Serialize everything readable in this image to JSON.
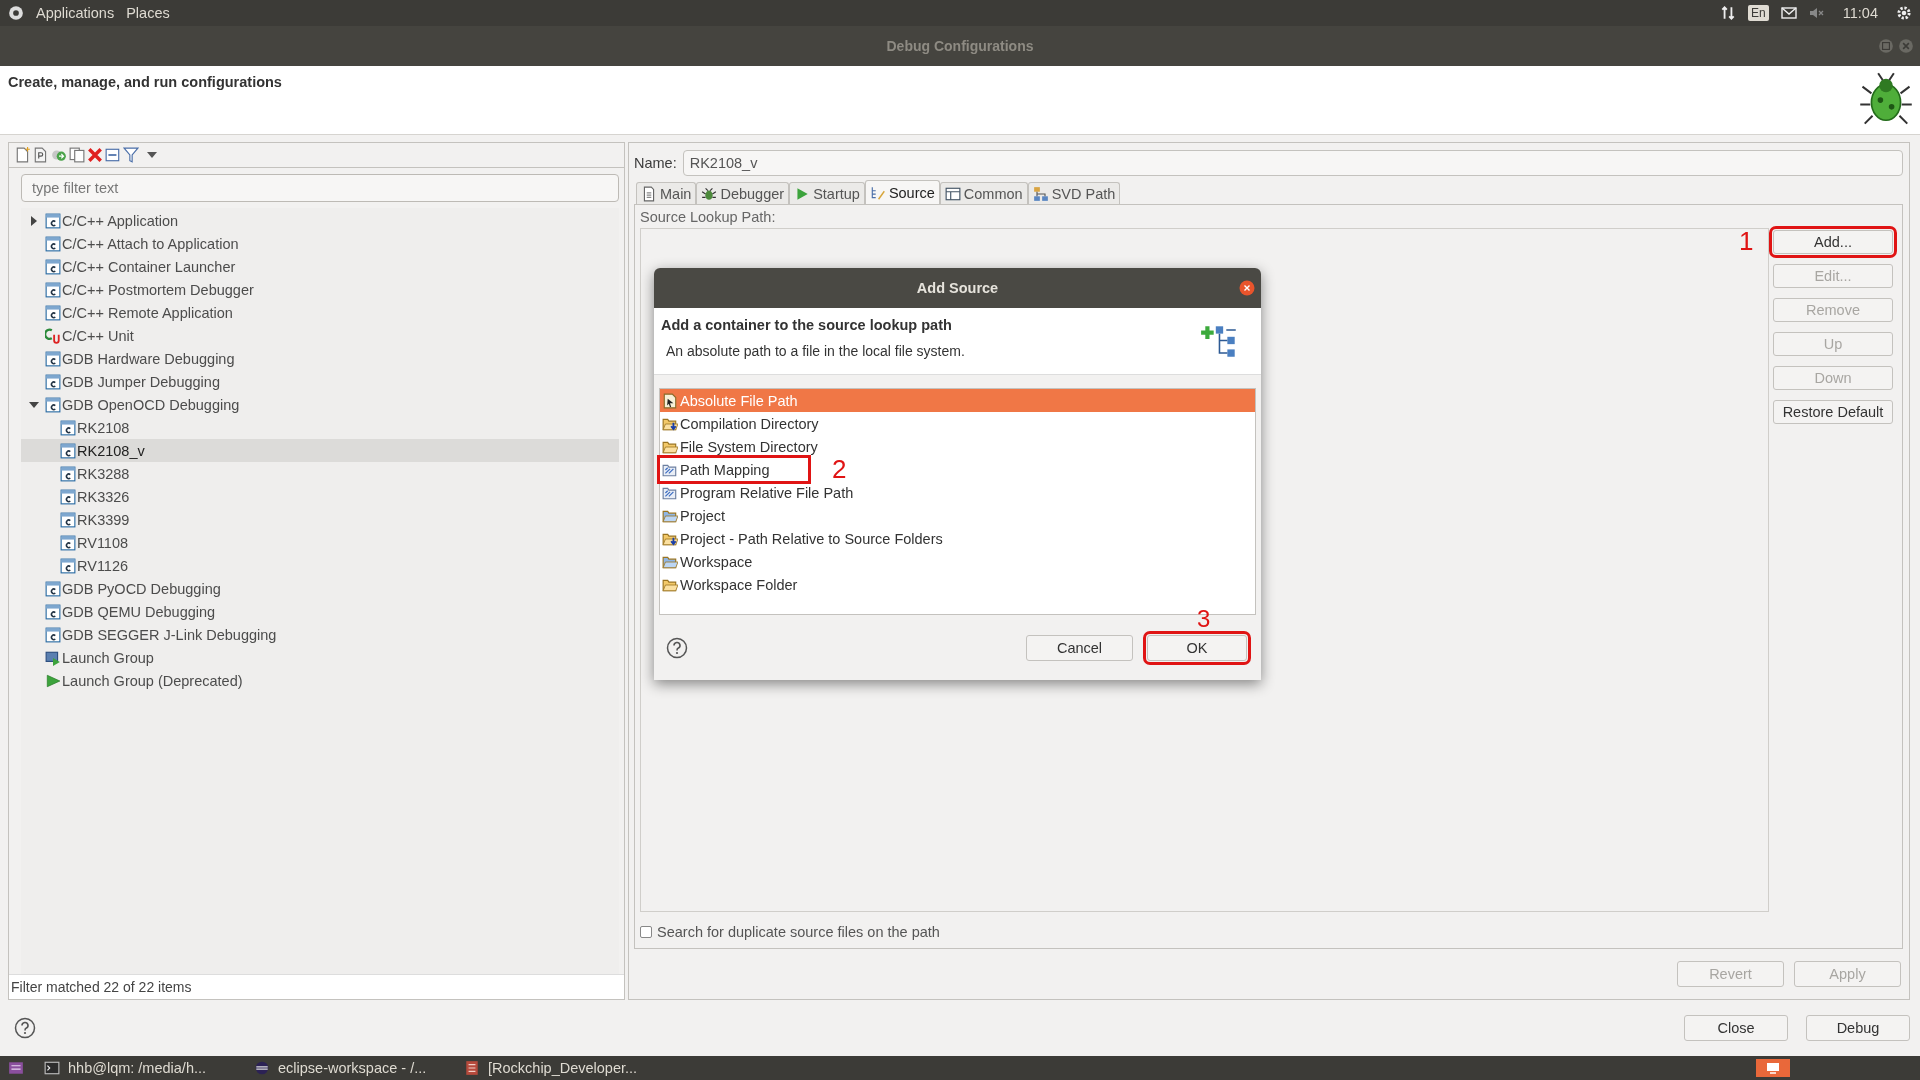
{
  "top_panel": {
    "menus": [
      "Applications",
      "Places"
    ],
    "keyboard": "En",
    "time": "11:04"
  },
  "window": {
    "title": "Debug Configurations"
  },
  "header": {
    "title": "Create, manage, and run configurations"
  },
  "left": {
    "filter_placeholder": "type filter text",
    "status": "Filter matched 22 of 22 items",
    "tree": [
      {
        "label": "C/C++ Application",
        "kind": "config",
        "expanded": false,
        "selected": false
      },
      {
        "label": "C/C++ Attach to Application",
        "kind": "config",
        "selected": false
      },
      {
        "label": "C/C++ Container Launcher",
        "kind": "config",
        "selected": false
      },
      {
        "label": "C/C++ Postmortem Debugger",
        "kind": "config",
        "selected": false
      },
      {
        "label": "C/C++ Remote Application",
        "kind": "config",
        "selected": false
      },
      {
        "label": "C/C++ Unit",
        "kind": "unit",
        "selected": false
      },
      {
        "label": "GDB Hardware Debugging",
        "kind": "config",
        "selected": false
      },
      {
        "label": "GDB Jumper Debugging",
        "kind": "config",
        "selected": false
      },
      {
        "label": "GDB OpenOCD Debugging",
        "kind": "config",
        "expanded": true,
        "selected": false,
        "children": [
          {
            "label": "RK2108",
            "kind": "config",
            "selected": false
          },
          {
            "label": "RK2108_v",
            "kind": "config",
            "selected": true
          },
          {
            "label": "RK3288",
            "kind": "config",
            "selected": false
          },
          {
            "label": "RK3326",
            "kind": "config",
            "selected": false
          },
          {
            "label": "RK3399",
            "kind": "config",
            "selected": false
          },
          {
            "label": "RV1108",
            "kind": "config",
            "selected": false
          },
          {
            "label": "RV1126",
            "kind": "config",
            "selected": false
          }
        ]
      },
      {
        "label": "GDB PyOCD Debugging",
        "kind": "config",
        "selected": false
      },
      {
        "label": "GDB QEMU Debugging",
        "kind": "config",
        "selected": false
      },
      {
        "label": "GDB SEGGER J-Link Debugging",
        "kind": "config",
        "selected": false
      },
      {
        "label": "Launch Group",
        "kind": "group",
        "selected": false
      },
      {
        "label": "Launch Group (Deprecated)",
        "kind": "group_old",
        "selected": false
      }
    ]
  },
  "name": {
    "label": "Name:",
    "value": "RK2108_v"
  },
  "tabs": [
    {
      "label": "Main",
      "kind": "main",
      "selected": false
    },
    {
      "label": "Debugger",
      "kind": "debugger",
      "selected": false
    },
    {
      "label": "Startup",
      "kind": "startup",
      "selected": false
    },
    {
      "label": "Source",
      "kind": "source",
      "selected": true
    },
    {
      "label": "Common",
      "kind": "common",
      "selected": false
    },
    {
      "label": "SVD Path",
      "kind": "svd",
      "selected": false
    }
  ],
  "source": {
    "label": "Source Lookup Path:",
    "buttons": [
      {
        "label": "Add...",
        "disabled": false,
        "annotation": "1"
      },
      {
        "label": "Edit...",
        "disabled": true
      },
      {
        "label": "Remove",
        "disabled": true
      },
      {
        "label": "Up",
        "disabled": true
      },
      {
        "label": "Down",
        "disabled": true
      },
      {
        "label": "Restore Default",
        "disabled": false
      }
    ],
    "duplicate_check": {
      "label": "Search for duplicate source files on the path",
      "checked": false
    }
  },
  "actions": [
    {
      "label": "Revert",
      "disabled": true
    },
    {
      "label": "Apply",
      "disabled": true
    }
  ],
  "footer_buttons": [
    "Close",
    "Debug"
  ],
  "taskbar": [
    {
      "label": "hhb@lqm: /media/h...",
      "kind": "terminal"
    },
    {
      "label": "eclipse-workspace - /...",
      "kind": "eclipse"
    },
    {
      "label": "[Rockchip_Developer...",
      "kind": "document"
    }
  ],
  "dialog": {
    "title": "Add Source",
    "heading": "Add a container to the source lookup path",
    "description": "An absolute path to a file in the local file system.",
    "items": [
      {
        "label": "Absolute File Path",
        "kind": "file",
        "selected": true
      },
      {
        "label": "Compilation Directory",
        "kind": "folder_arrow",
        "selected": false
      },
      {
        "label": "File System Directory",
        "kind": "folder",
        "selected": false
      },
      {
        "label": "Path Mapping",
        "kind": "mapping",
        "selected": false,
        "annotation": "2"
      },
      {
        "label": "Program Relative File Path",
        "kind": "mapping",
        "selected": false
      },
      {
        "label": "Project",
        "kind": "folder_blue",
        "selected": false
      },
      {
        "label": "Project - Path Relative to Source Folders",
        "kind": "folder_arrow",
        "selected": false
      },
      {
        "label": "Workspace",
        "kind": "folder_blue",
        "selected": false
      },
      {
        "label": "Workspace Folder",
        "kind": "folder",
        "selected": false
      }
    ],
    "buttons": [
      {
        "label": "Cancel",
        "default": false
      },
      {
        "label": "OK",
        "default": true,
        "annotation": "3"
      }
    ]
  }
}
